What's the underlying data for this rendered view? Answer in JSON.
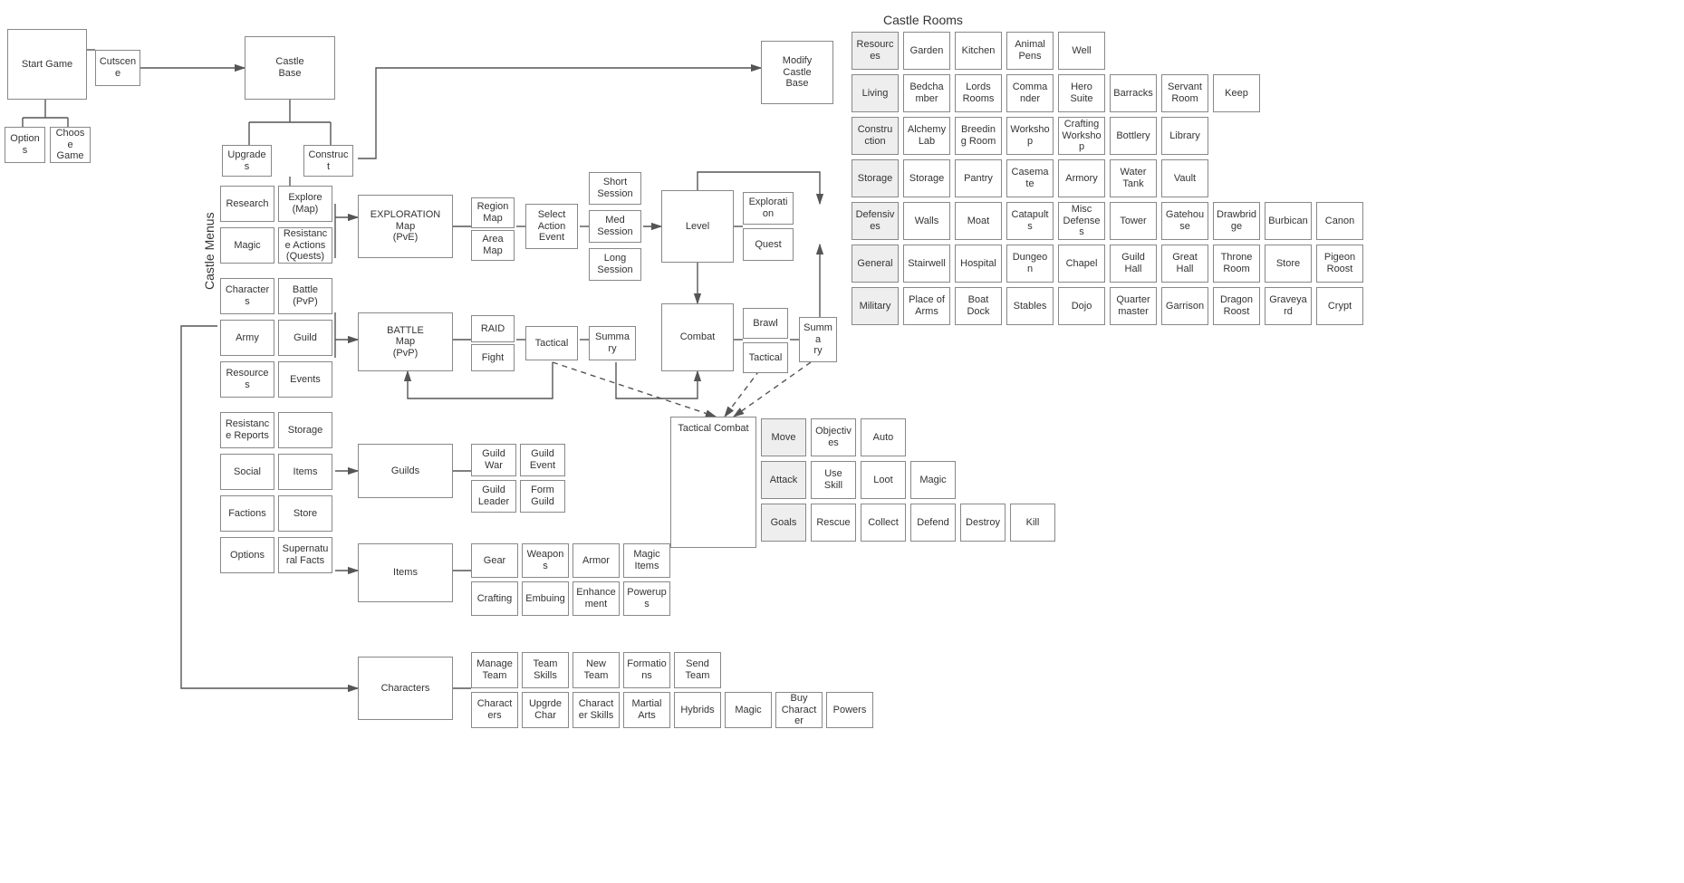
{
  "labels": {
    "castleRooms": "Castle Rooms",
    "castleMenus": "Castle Menus"
  },
  "top": {
    "startGame": "Start Game",
    "cutscene": "Cutscene",
    "castleBase": "Castle\nBase",
    "modifyCastleBase": "Modify\nCastle\nBase",
    "options": "Options",
    "chooseGame": "Choose\nGame",
    "upgrades": "Upgrades",
    "construct": "Construct"
  },
  "menuCols": [
    [
      "Research",
      "Magic",
      "Characters",
      "Army",
      "Resources",
      "Resistance Reports",
      "Social",
      "Factions",
      "Options"
    ],
    [
      "Explore (Map)",
      "Resistance Actions (Quests)",
      "Battle (PvP)",
      "Guild",
      "Events",
      "Storage",
      "Items",
      "Store",
      "Supernatural Facts"
    ]
  ],
  "explorationMap": "EXPLORATION\nMap\n(PvE)",
  "explorationSub": [
    "Region\nMap",
    "Area\nMap"
  ],
  "selectActionEvent": "Select\nAction\nEvent",
  "sessions": [
    "Short\nSession",
    "Med\nSession",
    "Long\nSession"
  ],
  "level": "Level",
  "levelSub": [
    "Exploration",
    "Quest"
  ],
  "combat": "Combat",
  "combatSub": [
    "Brawl",
    "Tactical"
  ],
  "summary": "Summa\nry",
  "battleMap": "BATTLE\nMap\n(PvP)",
  "battleSub": [
    "RAID",
    "Fight"
  ],
  "tactical": "Tactical",
  "battleSummary": "Summa\nry",
  "tacticalCombatTitle": "Tactical Combat",
  "tacticalCombat": {
    "rowLabels": [
      "Move",
      "Attack",
      "Goals"
    ],
    "rows": [
      [
        "Objectives",
        "Auto"
      ],
      [
        "Use Skill",
        "Loot",
        "Magic"
      ],
      [
        "Rescue",
        "Collect",
        "Defend",
        "Destroy",
        "Kill"
      ]
    ]
  },
  "guildsTitle": "Guilds",
  "guilds": [
    [
      "Guild War",
      "Guild Event"
    ],
    [
      "Guild Leader",
      "Form Guild"
    ]
  ],
  "itemsTitle": "Items",
  "items": [
    [
      "Gear",
      "Weapons",
      "Armor",
      "Magic Items"
    ],
    [
      "Crafting",
      "Embuing",
      "Enhancement",
      "Powerups"
    ]
  ],
  "charactersTitle": "Characters",
  "characters": [
    [
      "Manage Team",
      "Team Skills",
      "New Team",
      "Formations",
      "Send Team"
    ],
    [
      "Characters",
      "Upgrde Char",
      "Character Skills",
      "Martial Arts",
      "Hybrids",
      "Magic",
      "Buy Character",
      "Powers"
    ]
  ],
  "rooms": {
    "rowLabels": [
      "Resources",
      "Living",
      "Construction",
      "Storage",
      "Defensives",
      "General",
      "Military"
    ],
    "rows": [
      [
        "Garden",
        "Kitchen",
        "Animal Pens",
        "Well"
      ],
      [
        "Bedchamber",
        "Lords Rooms",
        "Commander",
        "Hero Suite",
        "Barracks",
        "Servant Room",
        "Keep"
      ],
      [
        "Alchemy Lab",
        "Breeding Room",
        "Workshop",
        "Crafting Workshop",
        "Bottlery",
        "Library"
      ],
      [
        "Storage",
        "Pantry",
        "Casemate",
        "Armory",
        "Water Tank",
        "Vault"
      ],
      [
        "Walls",
        "Moat",
        "Catapults",
        "Misc Defenses",
        "Tower",
        "Gatehouse",
        "Drawbridge",
        "Burbican",
        "Canon"
      ],
      [
        "Stairwell",
        "Hospital",
        "Dungeon",
        "Chapel",
        "Guild Hall",
        "Great Hall",
        "Throne Room",
        "Store",
        "Pigeon Roost"
      ],
      [
        "Place of Arms",
        "Boat Dock",
        "Stables",
        "Dojo",
        "Quarter master",
        "Garrison",
        "Dragon Roost",
        "Graveyard",
        "Crypt"
      ]
    ]
  }
}
